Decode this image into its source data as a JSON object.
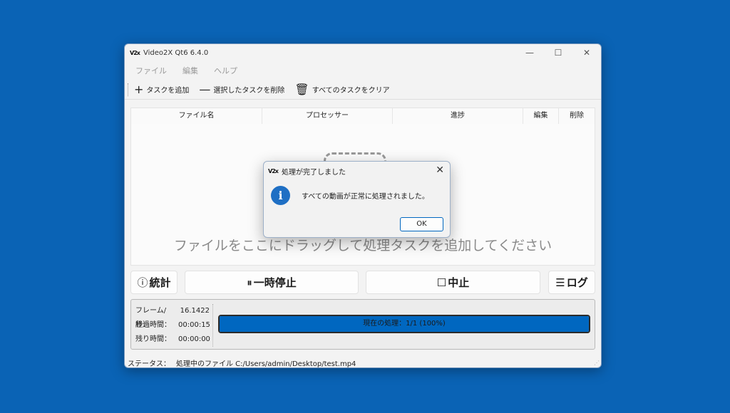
{
  "window": {
    "logo_text": "V2x",
    "title": "Video2X Qt6 6.4.0",
    "controls": {
      "minimize": "—",
      "maximize": "☐",
      "close": "✕"
    }
  },
  "menu": [
    "ファイル",
    "編集",
    "ヘルプ"
  ],
  "toolbar": {
    "add_task": "タスクを追加",
    "remove_task": "選択したタスクを削除",
    "clear_tasks": "すべてのタスクをクリア",
    "add_icon": "+",
    "remove_icon": "—",
    "clear_icon": "🗑"
  },
  "table": {
    "headers": [
      "ファイル名",
      "プロセッサー",
      "進捗",
      "編集",
      "削除"
    ],
    "drop_hint": "ファイルをここにドラッグして処理タスクを追加してください"
  },
  "controls": {
    "stats": "統計",
    "pause": "一時停止",
    "stop": "中止",
    "log": "ログ",
    "stats_icon": "ⓘ",
    "pause_icon": "⏸",
    "stop_icon": "☐",
    "log_icon": "☰"
  },
  "stats": {
    "fps_label": "フレーム/秒：",
    "fps_value": "16.1422",
    "elapsed_label": "経過時間：",
    "elapsed_value": "00:00:15",
    "remaining_label": "残り時間：",
    "remaining_value": "00:00:00"
  },
  "progress": {
    "label": "現在の処理：1/1 (100%)",
    "fraction": 1.0
  },
  "statusbar": {
    "label": "ステータス：",
    "text": "処理中のファイル C:/Users/admin/Desktop/test.mp4"
  },
  "dialog": {
    "title": "処理が完了しました",
    "message": "すべての動画が正常に処理されました。",
    "ok": "OK",
    "close": "✕",
    "info_icon": "i"
  },
  "colors": {
    "desktop": "#0a63b5",
    "accent": "#0067c0"
  }
}
